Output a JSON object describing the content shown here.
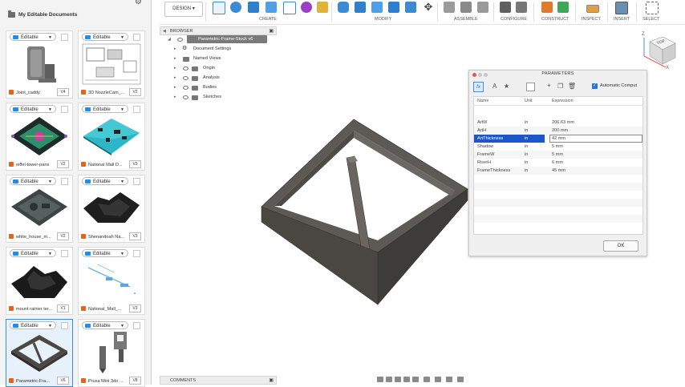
{
  "data_panel": {
    "title": "My Editable Documents",
    "cards": [
      {
        "badge": "Editable",
        "name": "Joint_caddy",
        "version": "V4"
      },
      {
        "badge": "Editable",
        "name": "3D NozzleCam_...",
        "version": "V2"
      },
      {
        "badge": "Editable",
        "name": "eiffel-tower-paris",
        "version": "V2"
      },
      {
        "badge": "Editable",
        "name": "National Mall D...",
        "version": "V3"
      },
      {
        "badge": "Editable",
        "name": "white_house_m...",
        "version": "V2"
      },
      {
        "badge": "Editable",
        "name": "Shenandoah Na...",
        "version": "V3"
      },
      {
        "badge": "Editable",
        "name": "mount rainier ter...",
        "version": "V1"
      },
      {
        "badge": "Editable",
        "name": "National_Mall_...",
        "version": "V3"
      },
      {
        "badge": "Editable",
        "name": "Parametric-Fra...",
        "version": "V6"
      },
      {
        "badge": "Editable",
        "name": "Prusa Mini 3do ...",
        "version": "V8"
      }
    ]
  },
  "toolbar": {
    "workspace": "DESIGN",
    "groups": [
      "CREATE",
      "MODIFY",
      "ASSEMBLE",
      "CONFIGURE",
      "CONSTRUCT",
      "INSPECT",
      "INSERT",
      "SELECT"
    ]
  },
  "browser": {
    "title": "BROWSER",
    "document": "Parametric-Frame-Stock v6",
    "items": [
      "Document Settings",
      "Named Views",
      "Origin",
      "Analysis",
      "Bodies",
      "Sketches"
    ]
  },
  "viewcube": {
    "face": "TOP",
    "axis_z": "Z",
    "axis_x": "X"
  },
  "parameters": {
    "title": "PARAMETERS",
    "auto_compute_label": "Automatic Comput",
    "columns": [
      "Name",
      "Unit",
      "Expression"
    ],
    "rows": [
      {
        "name": "ArtW",
        "unit": "in",
        "expr": "206.63 mm"
      },
      {
        "name": "ArtH",
        "unit": "in",
        "expr": "200 mm"
      },
      {
        "name": "ArtThickness",
        "unit": "in",
        "expr": "42 mm"
      },
      {
        "name": "Shadow",
        "unit": "in",
        "expr": "5 mm"
      },
      {
        "name": "FrameW",
        "unit": "in",
        "expr": "5 mm"
      },
      {
        "name": "RiserH",
        "unit": "in",
        "expr": "6 mm"
      },
      {
        "name": "FrameThickness",
        "unit": "in",
        "expr": "45 mm"
      }
    ],
    "ok_label": "OK"
  },
  "comments": {
    "title": "COMMENTS"
  },
  "colors": {
    "accent": "#1c56c8",
    "editable_blue": "#2a8cd8",
    "model_gray": "#5d5a55"
  }
}
